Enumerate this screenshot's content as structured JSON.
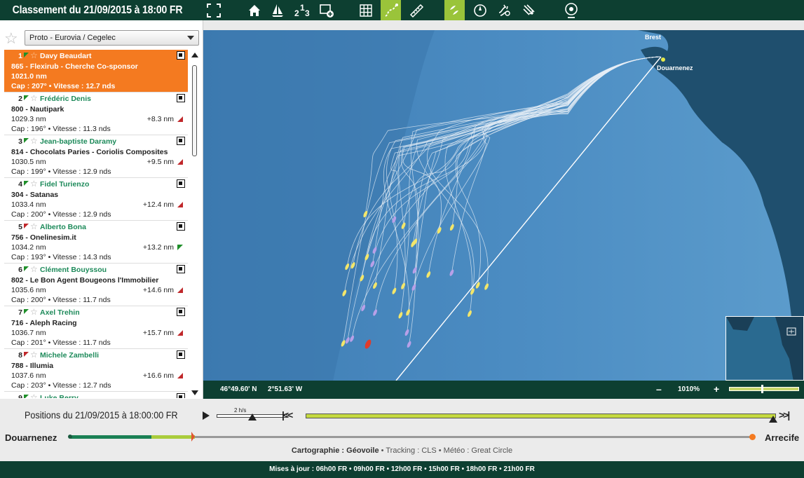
{
  "header": {
    "title": "Classement du 21/09/2015 à 18:00:00 FR",
    "title_short": "Classement du 21/09/2015 à 18:00 FR"
  },
  "toolbar": {
    "icons": [
      "fullscreen-icon",
      "home-icon",
      "sailboat-icon",
      "ranking-icon",
      "add-layer-icon",
      "grid-icon",
      "tracks-icon",
      "ruler-icon",
      "boats-layer-icon",
      "compass-icon",
      "wind-icon",
      "wind-arrows-icon",
      "weather-icon"
    ],
    "active": [
      "tracks-icon",
      "boats-layer-icon"
    ]
  },
  "sidebar": {
    "class_select": "Proto - Eurovia / Cegelec",
    "rows": [
      {
        "rank": "1",
        "trend_flag": "green",
        "skipper": "Davy Beaudart",
        "boat": "865 - Flexirub - Cherche Co-sponsor",
        "dist": "1021.0 nm",
        "gap": "",
        "gap_trend": "",
        "cap": "Cap : 207° • Vitesse : 12.7 nds"
      },
      {
        "rank": "2",
        "trend_flag": "green",
        "skipper": "Frédéric Denis",
        "boat": "800 - Nautipark",
        "dist": "1029.3 nm",
        "gap": "+8.3 nm",
        "gap_trend": "red",
        "cap": "Cap : 196° • Vitesse : 11.3 nds"
      },
      {
        "rank": "3",
        "trend_flag": "green",
        "skipper": "Jean-baptiste Daramy",
        "boat": "814 - Chocolats Paries - Coriolis Composites",
        "dist": "1030.5 nm",
        "gap": "+9.5 nm",
        "gap_trend": "red",
        "cap": "Cap : 199° • Vitesse : 12.9 nds"
      },
      {
        "rank": "4",
        "trend_flag": "green",
        "skipper": "Fidel Turienzo",
        "boat": "304 - Satanas",
        "dist": "1033.4 nm",
        "gap": "+12.4 nm",
        "gap_trend": "red",
        "cap": "Cap : 200° • Vitesse : 12.9 nds"
      },
      {
        "rank": "5",
        "trend_flag": "red",
        "skipper": "Alberto Bona",
        "boat": "756 - Onelinesim.it",
        "dist": "1034.2 nm",
        "gap": "+13.2 nm",
        "gap_trend": "green",
        "cap": "Cap : 193° • Vitesse : 14.3 nds"
      },
      {
        "rank": "6",
        "trend_flag": "green",
        "skipper": "Clément Bouyssou",
        "boat": "802 - Le Bon Agent Bougeons l'Immobilier",
        "dist": "1035.6 nm",
        "gap": "+14.6 nm",
        "gap_trend": "red",
        "cap": "Cap : 200° • Vitesse : 11.7 nds"
      },
      {
        "rank": "7",
        "trend_flag": "green",
        "skipper": "Axel Trehin",
        "boat": "716 - Aleph Racing",
        "dist": "1036.7 nm",
        "gap": "+15.7 nm",
        "gap_trend": "red",
        "cap": "Cap : 201° • Vitesse : 11.7 nds"
      },
      {
        "rank": "8",
        "trend_flag": "red",
        "skipper": "Michele Zambelli",
        "boat": "788 - Illumia",
        "dist": "1037.6 nm",
        "gap": "+16.6 nm",
        "gap_trend": "red",
        "cap": "Cap : 203° • Vitesse : 12.7 nds"
      },
      {
        "rank": "9",
        "trend_flag": "green",
        "skipper": "Luke Berry",
        "boat": "",
        "dist": "",
        "gap": "",
        "gap_trend": "",
        "cap": ""
      }
    ]
  },
  "map": {
    "labels": {
      "brest": "Brest",
      "douarnenez": "Douarnenez"
    },
    "lat": "46°49.60' N",
    "lon": "2°51.63' W",
    "zoom_minus": "–",
    "zoom": "1010%",
    "zoom_plus": "+",
    "colors": {
      "sea": "#4a8ac0",
      "land": "#1f4f6e",
      "track": "#e6eef5",
      "boat_yellow": "#f3e66a",
      "boat_purple": "#b8a0e8",
      "leader": "#e03b2a"
    }
  },
  "timeline": {
    "positions_label": "Positions du 21/09/2015 à 18:00:00 FR",
    "speed_label": "2 h/s",
    "start": "Douarnenez",
    "end": "Arrecife",
    "credits_label": "Cartographie :",
    "credits_carto": "Géovoile",
    "credits_rest": " • Tracking : CLS • Météo : Great Circle"
  },
  "footer": {
    "text": "Mises à jour : 06h00 FR • 09h00 FR • 12h00 FR • 15h00 FR • 18h00 FR • 21h00 FR"
  }
}
